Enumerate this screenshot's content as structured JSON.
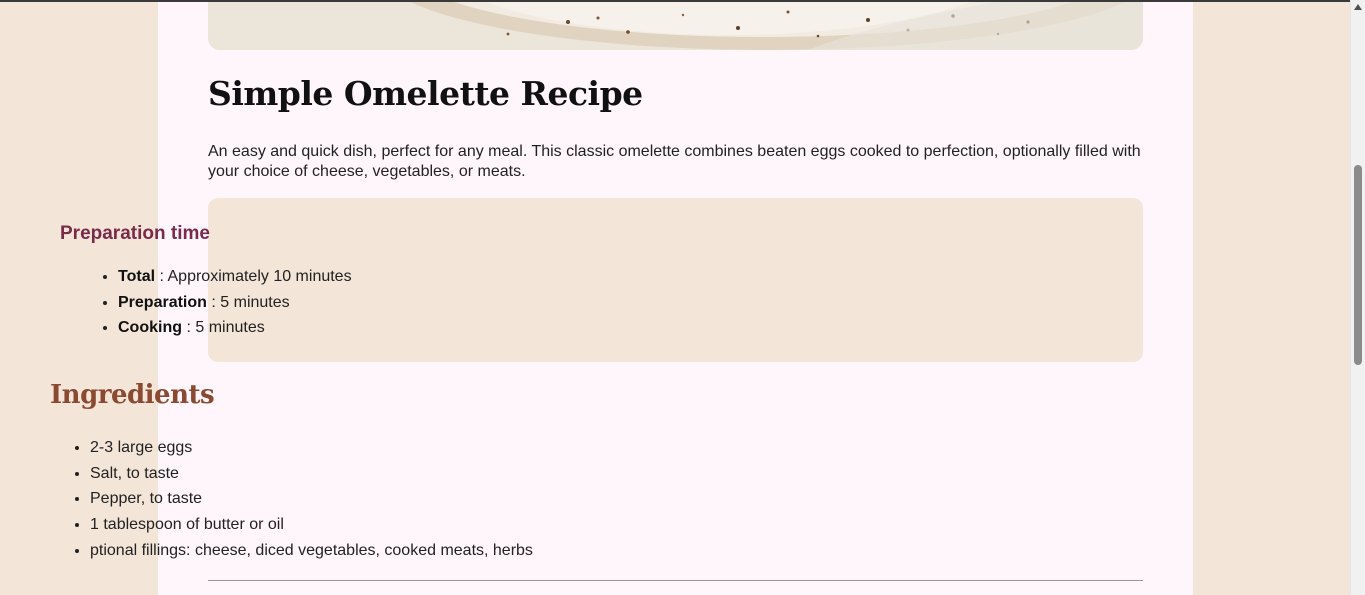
{
  "recipe": {
    "title": "Simple Omelette Recipe",
    "intro": "An easy and quick dish, perfect for any meal. This classic omelette combines beaten eggs cooked to perfection, optionally filled with your choice of cheese, vegetables, or meats.",
    "preparation": {
      "heading": "Preparation time",
      "items": [
        {
          "label": "Total",
          "value": ": Approximately 10 minutes"
        },
        {
          "label": "Preparation",
          "value": ": 5 minutes"
        },
        {
          "label": "Cooking",
          "value": ": 5 minutes"
        }
      ]
    },
    "ingredients": {
      "heading": "Ingredients",
      "items": [
        "2-3 large eggs",
        "Salt, to taste",
        "Pepper, to taste",
        "1 tablespoon of butter or oil",
        "ptional fillings: cheese, diced vegetables, cooked meats, herbs"
      ]
    }
  },
  "colors": {
    "page_background": "#f3e5d8",
    "card_background": "#fff6fb",
    "prep_heading": "#7a2a4a",
    "ingredients_heading": "#8a4a32"
  },
  "icons": {
    "scroll_up": "triangle-up-icon"
  }
}
